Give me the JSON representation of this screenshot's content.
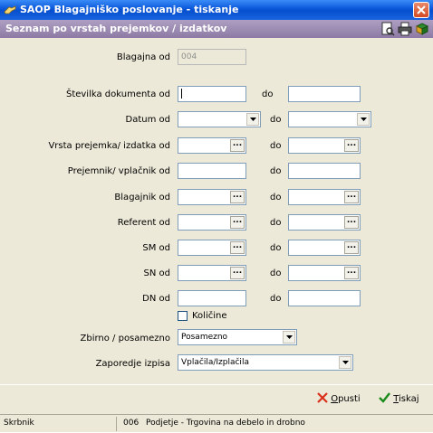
{
  "window": {
    "title": "SAOP Blagajniško poslovanje - tiskanje"
  },
  "header": {
    "title": "Seznam po vrstah prejemkov / izdatkov"
  },
  "form": {
    "blagajna_od": {
      "label": "Blagajna od",
      "value": "004"
    },
    "stevilka": {
      "label": "Številka dokumenta od",
      "do": "do",
      "from": "",
      "to": ""
    },
    "datum": {
      "label": "Datum od",
      "do": "do",
      "from": "",
      "to": ""
    },
    "vrsta": {
      "label": "Vrsta prejemka/ izdatka od",
      "do": "do",
      "from": "",
      "to": ""
    },
    "prejemnik": {
      "label": "Prejemnik/ vplačnik od",
      "do": "do",
      "from": "",
      "to": ""
    },
    "blagajnik": {
      "label": "Blagajnik od",
      "do": "do",
      "from": "",
      "to": ""
    },
    "referent": {
      "label": "Referent od",
      "do": "do",
      "from": "",
      "to": ""
    },
    "sm": {
      "label": "SM od",
      "do": "do",
      "from": "",
      "to": ""
    },
    "sn": {
      "label": "SN od",
      "do": "do",
      "from": "",
      "to": ""
    },
    "dn": {
      "label": "DN od",
      "do": "do",
      "from": "",
      "to": ""
    },
    "kolicine": {
      "label": "Količine",
      "checked": false
    },
    "zbirno": {
      "label": "Zbirno / posamezno",
      "value": "Posamezno"
    },
    "zaporedje": {
      "label": "Zaporedje izpisa",
      "value": "Vplačila/Izplačila"
    },
    "ellipsis": "..."
  },
  "buttons": {
    "cancel_hotkey": "O",
    "cancel_rest": "pusti",
    "print_hotkey": "T",
    "print_rest": "iskaj"
  },
  "status": {
    "user": "Skrbnik",
    "code": "006",
    "company": "Podjetje - Trgovina na debelo in drobno"
  },
  "colors": {
    "titlebar": "#0a57d9",
    "subheader": "#8d7aa4",
    "cancel": "#d9301a",
    "print": "#1a8a1a"
  }
}
